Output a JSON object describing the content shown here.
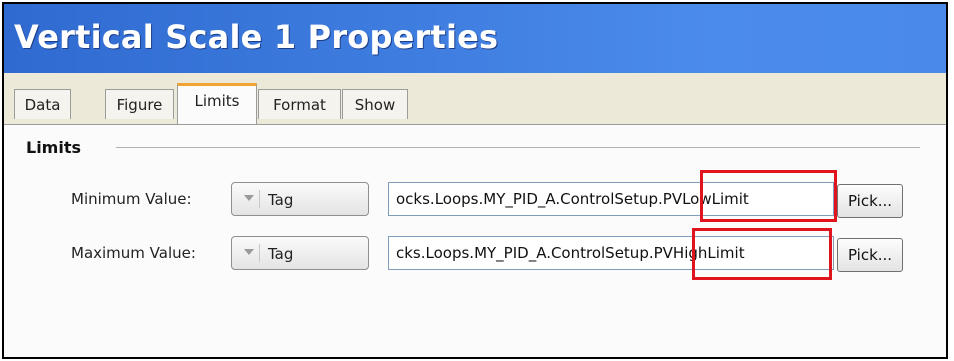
{
  "dialog": {
    "title": "Vertical Scale 1 Properties"
  },
  "tabs": [
    {
      "label": "Data"
    },
    {
      "label": "Figure"
    },
    {
      "label": "Limits"
    },
    {
      "label": "Format"
    },
    {
      "label": "Show"
    }
  ],
  "active_tab": "Limits",
  "limits": {
    "group_label": "Limits",
    "minimum": {
      "label": "Minimum Value:",
      "source": "Tag",
      "path": "ocks.Loops.MY_PID_A.ControlSetup.PVLowLimit",
      "pick_label": "Pick..."
    },
    "maximum": {
      "label": "Maximum Value:",
      "source": "Tag",
      "path": "cks.Loops.MY_PID_A.ControlSetup.PVHighLimit",
      "pick_label": "Pick..."
    }
  },
  "colors": {
    "title_bar": "#3f7ee0",
    "active_tab_accent": "#f1a433",
    "highlight": "#e0141e"
  }
}
